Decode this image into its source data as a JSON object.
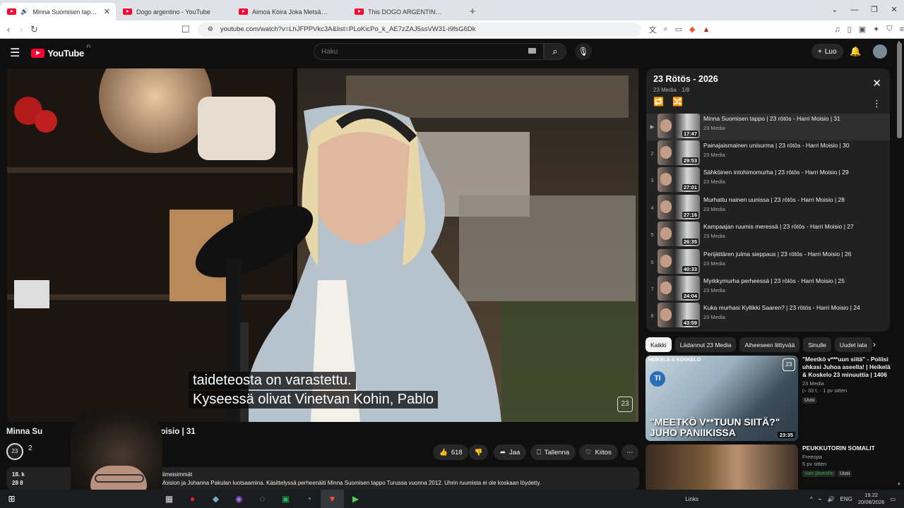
{
  "browser": {
    "tabs": [
      {
        "title": "Minna Suomisen tappo | 23 r…",
        "active": true
      },
      {
        "title": "Dogo argentino - YouTube",
        "active": false
      },
      {
        "title": "Aimoa Koira Joka Metsästää Pumaja",
        "active": false
      },
      {
        "title": "This DOGO ARGENTINO was a hero",
        "active": false
      }
    ],
    "url": "youtube.com/watch?v=LhJFPPVkc3A&list=PLoKicPo_k_AE7zZAJ5ssVW31-i9fsG6Dk"
  },
  "header": {
    "logo_text": "YouTube",
    "logo_country": "FI",
    "search_placeholder": "Haku",
    "create_label": "Luo"
  },
  "video": {
    "subtitle_lines": [
      "taideteosta on varastettu.",
      "Kyseessä olivat Vinetvan Kohin, Pablo"
    ],
    "badge": "23",
    "title_left": "Minna Su",
    "title_right": "arri Moisio | 31",
    "channel_avatar": "23",
    "channel_name": "2",
    "likes": "618",
    "share_label": "Jaa",
    "save_label": "Tallenna",
    "thanks_label": "Kiitos",
    "more_icon": "⋯",
    "desc_meta_left": "18. k",
    "desc_meta_right": "Viimeisimmät",
    "desc_left2": "28 8",
    "description": "Harri Moision ja Johanna Pakulan luotsaamina. Käsittelyssä perheenäiti Minna Suomisen tappo Turussa vuonna 2012. Uhrin ruumista ei ole koskaan löydetty."
  },
  "playlist": {
    "title": "23 Rötös - 2026",
    "subtitle": "23 Media · 1/8",
    "items": [
      {
        "index": "▶",
        "title": "Minna Suomisen tappo | 23 rötös - Harri Moisio | 31",
        "channel": "23 Media",
        "duration": "17:47",
        "current": true
      },
      {
        "index": "2",
        "title": "Painajaismainen unisurma | 23 rötös - Harri Moisio | 30",
        "channel": "23 Media",
        "duration": "29:53",
        "current": false
      },
      {
        "index": "3",
        "title": "Sähköinen intohimomurha | 23 rötös - Harri Moisio | 29",
        "channel": "23 Media",
        "duration": "27:01",
        "current": false
      },
      {
        "index": "4",
        "title": "Murhattu nainen uunissa | 23 rötös - Harri Moisio | 28",
        "channel": "23 Media",
        "duration": "27:16",
        "current": false
      },
      {
        "index": "5",
        "title": "Kampaajan ruumis meressä | 23 rötös - Harri Moisio | 27",
        "channel": "23 Media",
        "duration": "26:35",
        "current": false
      },
      {
        "index": "6",
        "title": "Perijättären julma sieppaus | 23 rötös - Harri Moisio | 26",
        "channel": "23 Media",
        "duration": "40:33",
        "current": false
      },
      {
        "index": "7",
        "title": "Myrkkymurha perheessä | 23 rötös - Harri Moisio | 25",
        "channel": "23 Media",
        "duration": "24:04",
        "current": false
      },
      {
        "index": "8",
        "title": "Kuka murhasi Kyllikki Saaren? | 23 rötös - Harri Moisio | 24",
        "channel": "23 Media",
        "duration": "43:59",
        "current": false
      }
    ]
  },
  "chips": [
    "Kaikki",
    "Lädannut 23 Media",
    "Aiheeseen liittyvää",
    "Sinulle",
    "Uudet lata"
  ],
  "recommendations": [
    {
      "title": "\"Meetkö v***uun siitä\" - Poliisi uhkasi Juhoa aseella! | Heikelä & Koskelo 23 minuuttia | 1406",
      "channel": "23 Media",
      "views": "▷ 33 t. · 1 pv sitten",
      "tag": "Uusi",
      "duration": "23:35",
      "thumb_brand": "HEIKELÄ & KOSKELO",
      "thumb_logo": "TI",
      "thumb_badge": "23",
      "thumb_caption": "\"MEETKÖ V**TUUN SIITÄ?\" JUHO PANIIKISSA"
    },
    {
      "title": "PEUKKUTORIN SOMALIT",
      "channel": "Freeopa",
      "views": "5 pv sitten",
      "tag": "Vain jäsenille",
      "tag2": "Uusi",
      "duration": ""
    }
  ],
  "taskbar": {
    "links_label": "Links",
    "lang": "ENG",
    "time": "19.22",
    "date": "20/08/2026"
  },
  "colors": {
    "brand_red": "#ff0033",
    "bg": "#0f0f0f",
    "panel": "#212121"
  }
}
